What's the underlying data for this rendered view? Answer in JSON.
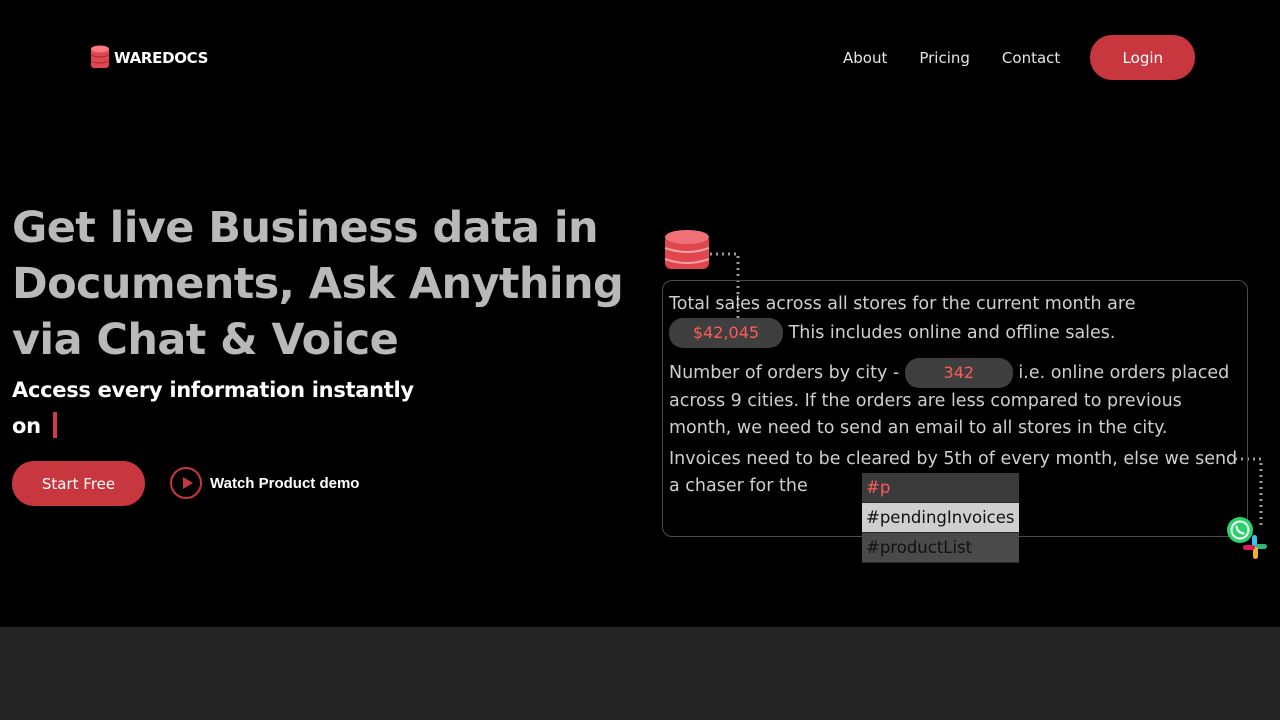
{
  "brand": {
    "name": "WAREDOCS",
    "accent": "#c8363e"
  },
  "nav": {
    "links": [
      "About",
      "Pricing",
      "Contact"
    ],
    "login_label": "Login"
  },
  "hero": {
    "title_lines": [
      "Get live Business data in",
      "Documents, Ask Anything",
      "via Chat & Voice"
    ],
    "subtitle_line1": "Access every information instantly",
    "subtitle_line2": "on",
    "start_label": "Start Free",
    "demo_label": "Watch Product demo"
  },
  "doc": {
    "p1_pre": "Total sales across all stores for the current month are",
    "p1_value": "$42,045",
    "p1_post": "This includes online and offline sales.",
    "p2_pre": "Number of orders by city -",
    "p2_value": "342",
    "p2_post": "i.e. online orders placed across 9 cities. If the orders are less compared to previous month, we need to send an email to all stores in the city.",
    "p3": "Invoices need to be cleared by 5th of every month, else we send a chaser for the",
    "suggestions": {
      "typed": "#p",
      "items": [
        "#pendingInvoices",
        "#productList"
      ]
    }
  },
  "icons": [
    "database-icon",
    "play-icon",
    "whatsapp-icon",
    "slack-icon"
  ]
}
